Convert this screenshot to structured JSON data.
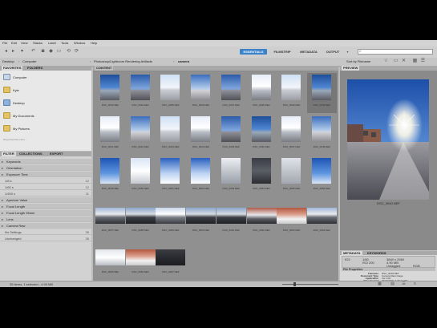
{
  "menu": [
    "File",
    "Edit",
    "View",
    "Stacks",
    "Label",
    "Tools",
    "Window",
    "Help"
  ],
  "workspaces": [
    "ESSENTIALS",
    "FILMSTRIP",
    "METADATA",
    "OUTPUT"
  ],
  "search_placeholder": "",
  "path": {
    "items": [
      "Desktop",
      "Computer",
      "Photoshop/Lightroom Rendering Artifacts",
      "camera"
    ]
  },
  "sort_label": "Sort by Filename",
  "favorites_tabs": [
    "FAVORITES",
    "FOLDERS"
  ],
  "favorites": [
    "Computer",
    "Kyle",
    "Desktop",
    "My Documents",
    "My Pictures"
  ],
  "favorites_hint": "Drag Favorites Here...",
  "filter_tabs": [
    "FILTER",
    "COLLECTIONS",
    "EXPORT"
  ],
  "filter": [
    {
      "label": "Keywords",
      "count": "",
      "kind": "cat"
    },
    {
      "label": "Orientation",
      "count": "",
      "kind": "cat"
    },
    {
      "label": "Exposure Time",
      "count": "",
      "kind": "cat"
    },
    {
      "label": "1/8 s",
      "count": "12",
      "kind": "sub"
    },
    {
      "label": "1/60 s",
      "count": "12",
      "kind": "sub"
    },
    {
      "label": "1/400 s",
      "count": "11",
      "kind": "sub"
    },
    {
      "label": "Aperture Value",
      "count": "",
      "kind": "cat"
    },
    {
      "label": "Focal Length",
      "count": "",
      "kind": "cat"
    },
    {
      "label": "Focal Length 35mm",
      "count": "",
      "kind": "cat"
    },
    {
      "label": "Lens",
      "count": "",
      "kind": "cat"
    },
    {
      "label": "Camera Raw",
      "count": "",
      "kind": "cat"
    },
    {
      "label": "No Settings",
      "count": "35",
      "kind": "sub"
    },
    {
      "label": "Unchanged",
      "count": "35",
      "kind": "sub"
    }
  ],
  "content_tab": "CONTENT",
  "thumbnails": [
    {
      "caption": "DSC_0033.NEF",
      "type": "p1"
    },
    {
      "caption": "DSC_0034.NEF",
      "type": "p2"
    },
    {
      "caption": "DSC_0035.NEF",
      "type": "p3"
    },
    {
      "caption": "DSC_0036.NEF",
      "type": "p4"
    },
    {
      "caption": "DSC_0037.NEF",
      "type": "p2"
    },
    {
      "caption": "DSC_0038.NEF",
      "type": "p5"
    },
    {
      "caption": "DSC_0039.NEF",
      "type": "p3"
    },
    {
      "caption": "DSC_0040.NEF",
      "type": "p1",
      "selected": true
    },
    {
      "caption": "DSC_0041.NEF",
      "type": "p5"
    },
    {
      "caption": "DSC_0042.NEF",
      "type": "p4"
    },
    {
      "caption": "DSC_0043.NEF",
      "type": "p3"
    },
    {
      "caption": "DSC_0044.NEF",
      "type": "p5"
    },
    {
      "caption": "DSC_0045.NEF",
      "type": "p2"
    },
    {
      "caption": "DSC_0046.NEF",
      "type": "p1"
    },
    {
      "caption": "DSC_0047.NEF",
      "type": "p5"
    },
    {
      "caption": "DSC_0048.NEF",
      "type": "p4"
    },
    {
      "caption": "DSC_0049.NEF",
      "type": "p6"
    },
    {
      "caption": "DSC_0050.NEF",
      "type": "p7"
    },
    {
      "caption": "DSC_0051.NEF",
      "type": "p8"
    },
    {
      "caption": "DSC_0052.NEF",
      "type": "p8"
    },
    {
      "caption": "DSC_0053.NEF",
      "type": "p9"
    },
    {
      "caption": "DSC_0054.NEF",
      "type": "p10"
    },
    {
      "caption": "DSC_0055.NEF",
      "type": "p11"
    },
    {
      "caption": "DSC_0056.NEF",
      "type": "p6"
    },
    {
      "caption": "DSC_0057.NEF",
      "type": "l1"
    },
    {
      "caption": "DSC_0058.NEF",
      "type": "l2"
    },
    {
      "caption": "DSC_0059.NEF",
      "type": "l3"
    },
    {
      "caption": "DSC_0060.NEF",
      "type": "l2"
    },
    {
      "caption": "DSC_0061.NEF",
      "type": "l2"
    },
    {
      "caption": "DSC_0062.NEF",
      "type": "l4"
    },
    {
      "caption": "DSC_0063.NEF",
      "type": "l5"
    },
    {
      "caption": "DSC_0064.NEF",
      "type": "l1"
    },
    {
      "caption": "DSC_0065.NEF",
      "type": "l6"
    },
    {
      "caption": "DSC_0066.NEF",
      "type": "l5"
    },
    {
      "caption": "DSC_0067.NEF",
      "type": "l7"
    }
  ],
  "preview_tab": "PREVIEW",
  "preview_caption": "DSC_0040.NEF",
  "meta_tabs": [
    "METADATA",
    "KEYWORDS"
  ],
  "meta_quick": [
    "f/22",
    "1/60",
    "3840 x 2560",
    "4.90 MB",
    "ISO 200",
    "Untagged",
    "RGB"
  ],
  "file_props_title": "File Properties",
  "file_props": [
    {
      "label": "Filename",
      "value": "DSC_0040.NEF"
    },
    {
      "label": "Document Type",
      "value": "Camera Raw image"
    },
    {
      "label": "Application",
      "value": "Ver.1.00"
    },
    {
      "label": "Date Created",
      "value": "03/29/2009, 6:05:34 PM"
    }
  ],
  "status_text": "35 items, 1 selected - 4.90 MB",
  "colors": {
    "accent": "#3a82c9",
    "content_bg": "#909090"
  },
  "icons": [
    "back-icon",
    "forward-icon",
    "history-icon",
    "boomerang-icon",
    "camera-icon",
    "refine-icon",
    "open-icon",
    "rotate-left-icon",
    "rotate-right-icon",
    "search-icon",
    "star-filter-icon",
    "new-folder-icon",
    "delete-icon",
    "grid-view-icon",
    "list-view-icon"
  ]
}
